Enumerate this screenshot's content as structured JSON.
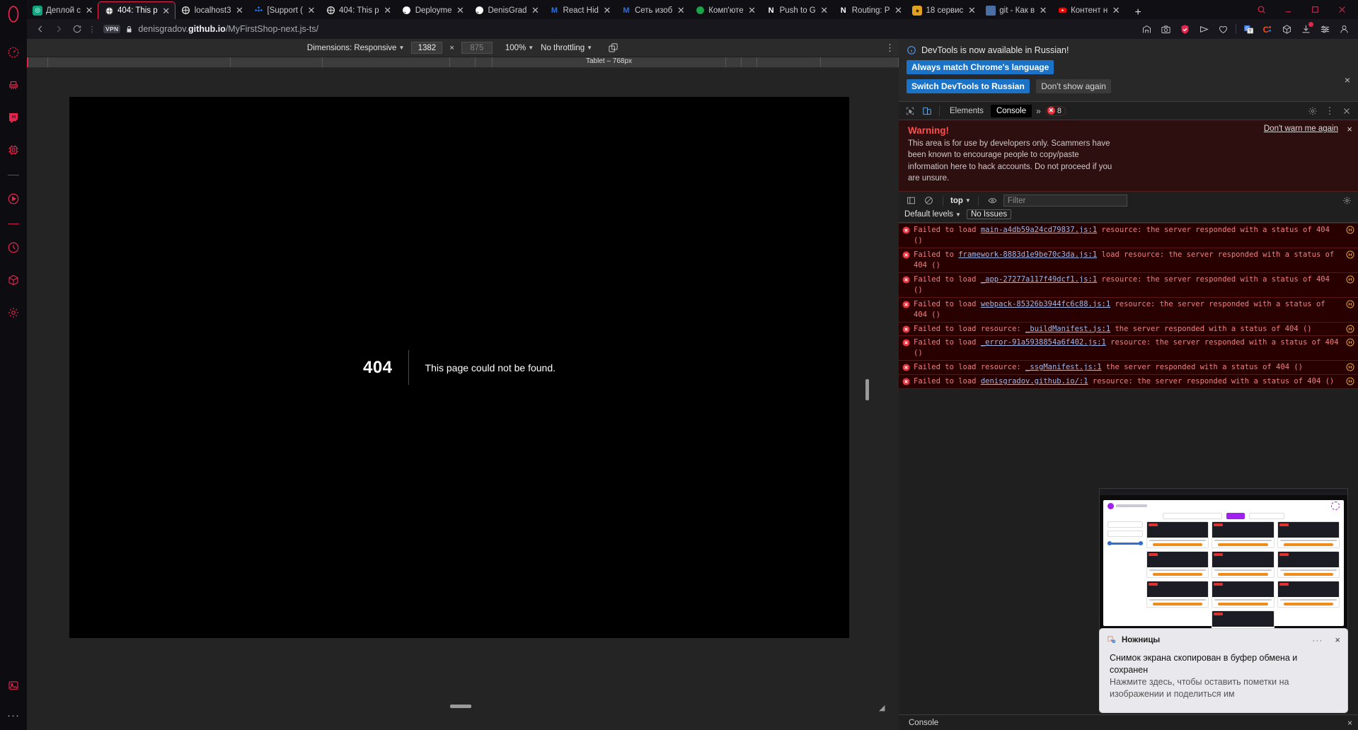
{
  "browser": {
    "tabs": [
      {
        "title": "Деплой с",
        "icon": "openai-icon",
        "active": false
      },
      {
        "title": "404: This p",
        "icon": "globe-icon",
        "active": true
      },
      {
        "title": "localhost3",
        "icon": "globe-icon",
        "active": false
      },
      {
        "title": "[Support (",
        "icon": "jira-icon",
        "active": false
      },
      {
        "title": "404: This p",
        "icon": "globe-icon",
        "active": false
      },
      {
        "title": "Deployme",
        "icon": "github-icon",
        "active": false
      },
      {
        "title": "DenisGrad",
        "icon": "github-icon",
        "active": false
      },
      {
        "title": "React Hid",
        "icon": "medium-icon",
        "active": false
      },
      {
        "title": "Сеть изоб",
        "icon": "medium-icon",
        "active": false
      },
      {
        "title": "Комп'юте",
        "icon": "green-globe-icon",
        "active": false
      },
      {
        "title": "Push to G",
        "icon": "notion-icon",
        "active": false
      },
      {
        "title": "Routing: P",
        "icon": "notion-icon",
        "active": false
      },
      {
        "title": "18 сервис",
        "icon": "yellow-icon",
        "active": false
      },
      {
        "title": "git - Как в",
        "icon": "stackoverflow-icon",
        "active": false
      },
      {
        "title": "Контент н",
        "icon": "youtube-icon",
        "active": false
      }
    ],
    "new_tab_label": "+",
    "window_controls": [
      "search-icon",
      "minimize-icon",
      "restore-icon",
      "close-icon"
    ],
    "nav": {
      "back": "back-icon",
      "forward": "forward-icon",
      "reload": "reload-icon"
    },
    "vpn_badge": "VPN",
    "url_prefix": "denisgradov.",
    "url_domain": "github.io",
    "url_suffix": "/MyFirstShop-next.js-ts/",
    "toolbar_icons": [
      "extension-pin-icon",
      "screenshot-icon",
      "shield-check-icon",
      "send-icon",
      "heart-icon",
      "translate-icon",
      "clipboard-c-icon",
      "cube-icon",
      "downloads-icon",
      "settings-sliders-icon",
      "profile-icon"
    ]
  },
  "device_toolbar": {
    "dimensions_label": "Dimensions: Responsive",
    "width_value": "1382",
    "height_placeholder": "875",
    "multiply": "×",
    "zoom_label": "100%",
    "throttling_label": "No throttling",
    "rotate_icon": "rotate-icon",
    "more_icon": "more-vertical-icon",
    "ruler_label": "Tablet – 768px"
  },
  "page": {
    "status_code": "404",
    "message": "This page could not be found."
  },
  "devtools": {
    "notice": {
      "text": "DevTools is now available in Russian!",
      "primary_button": "Always match Chrome's language",
      "secondary_button": "Switch DevTools to Russian",
      "tertiary_button": "Don't show again",
      "close": "×"
    },
    "tabs": [
      {
        "label": "Elements",
        "active": false
      },
      {
        "label": "Console",
        "active": true
      }
    ],
    "overflow_label": "»",
    "error_count": "8",
    "icons": {
      "inspect": "inspect-icon",
      "device": "device-toolbar-icon",
      "settings": "gear-icon",
      "more": "more-vertical-icon",
      "close": "close-icon"
    },
    "warning": {
      "title": "Warning!",
      "body": "This area is for use by developers only. Scammers have been known to encourage people to copy/paste information here to hack accounts. Do not proceed if you are unsure.",
      "dont_warn_link": "Don't warn me again",
      "close": "×"
    },
    "filter_bar": {
      "sidebar_icon": "console-sidebar-icon",
      "clear_icon": "clear-console-icon",
      "context_label": "top",
      "eye_icon": "live-expression-icon",
      "filter_placeholder": "Filter",
      "settings_icon": "gear-icon",
      "levels_label": "Default levels",
      "issues_label": "No Issues"
    },
    "messages": [
      {
        "pre": "Failed to load ",
        "src": "main-a4db59a24cd79837.js:1",
        "post": "resource: the server responded with a status of 404 ()"
      },
      {
        "pre": "Failed to ",
        "src": "framework-8883d1e9be70c3da.js:1",
        "post": "load resource: the server responded with a status of 404 ()"
      },
      {
        "pre": "Failed to load ",
        "src": "_app-27277a117f49dcf1.js:1",
        "post": "resource: the server responded with a status of 404 ()"
      },
      {
        "pre": "Failed to load ",
        "src": "webpack-85326b3944fc6c88.js:1",
        "post": "resource: the server responded with a status of 404 ()"
      },
      {
        "pre": "Failed to load resource: ",
        "src": "_buildManifest.js:1",
        "post": "the server responded with a status of 404 ()"
      },
      {
        "pre": "Failed to load ",
        "src": "_error-91a5938854a6f402.js:1",
        "post": "resource: the server responded with a status of 404 ()"
      },
      {
        "pre": "Failed to load resource: ",
        "src": "_ssgManifest.js:1",
        "post": "the server responded with a status of 404 ()"
      },
      {
        "pre": "Failed to load ",
        "src": "denisgradov.github.io/:1",
        "post": "resource: the server responded with a status of 404 ()"
      }
    ],
    "drawer_tab": "Console",
    "drawer_close": "×"
  },
  "snip_toast": {
    "app_name": "Ножницы",
    "title": "Снимок экрана скопирован в буфер обмена и сохранен",
    "subtitle": "Нажмите здесь, чтобы оставить пометки на изображении и поделиться им",
    "more": "···",
    "close": "×"
  },
  "sidebar": {
    "items": [
      {
        "name": "opera-logo",
        "label": "O"
      },
      {
        "name": "speed-dial-icon",
        "label": ""
      },
      {
        "name": "cleaner-icon",
        "label": ""
      },
      {
        "name": "twitch-icon",
        "label": ""
      },
      {
        "name": "cpu-icon",
        "label": ""
      },
      {
        "name": "player-icon",
        "label": ""
      },
      {
        "name": "history-icon",
        "label": ""
      },
      {
        "name": "box-icon",
        "label": ""
      },
      {
        "name": "settings-icon",
        "label": ""
      }
    ],
    "bottom": [
      {
        "name": "gallery-icon"
      },
      {
        "name": "more-horizontal-icon"
      }
    ]
  },
  "colors": {
    "accent": "#e4264f",
    "devtools_bg": "#1f1f1f",
    "warning_red": "#f6504f",
    "error_bg": "#290000",
    "link_blue": "#1a73c7"
  }
}
